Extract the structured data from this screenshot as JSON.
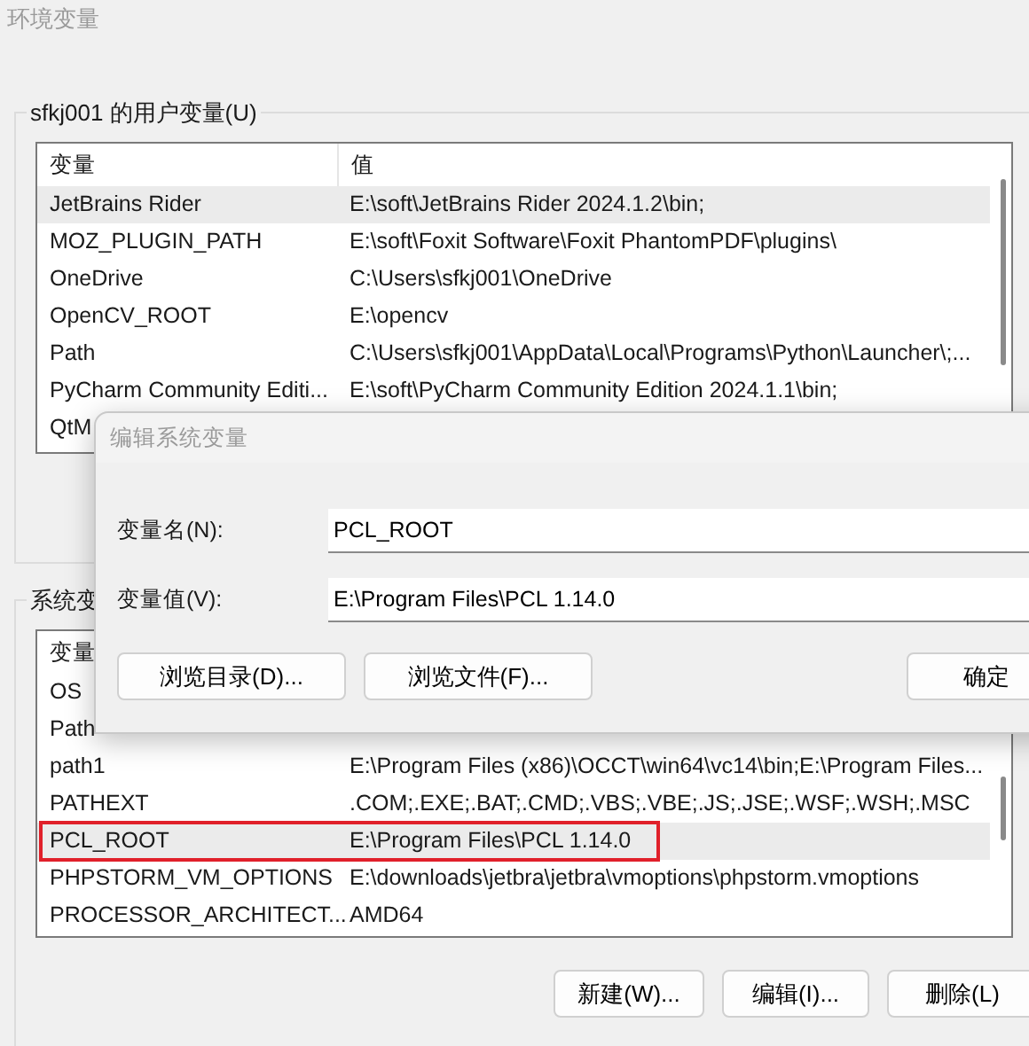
{
  "window": {
    "title": "环境变量"
  },
  "user_variables": {
    "label": "sfkj001 的用户变量(U)",
    "columns": [
      "变量",
      "值"
    ],
    "rows": [
      {
        "name": "JetBrains Rider",
        "value": "E:\\soft\\JetBrains Rider 2024.1.2\\bin;",
        "selected": true
      },
      {
        "name": "MOZ_PLUGIN_PATH",
        "value": "E:\\soft\\Foxit Software\\Foxit PhantomPDF\\plugins\\",
        "selected": false
      },
      {
        "name": "OneDrive",
        "value": "C:\\Users\\sfkj001\\OneDrive",
        "selected": false
      },
      {
        "name": "OpenCV_ROOT",
        "value": "E:\\opencv",
        "selected": false
      },
      {
        "name": "Path",
        "value": "C:\\Users\\sfkj001\\AppData\\Local\\Programs\\Python\\Launcher\\;...",
        "selected": false
      },
      {
        "name": "PyCharm Community Editi...",
        "value": "E:\\soft\\PyCharm Community Edition 2024.1.1\\bin;",
        "selected": false
      },
      {
        "name": "QtM",
        "selected": false
      }
    ]
  },
  "system_variables": {
    "label": "系统变",
    "columns": [
      "变量"
    ],
    "rows": [
      {
        "name": "OS",
        "selected": false,
        "marked": false
      },
      {
        "name": "Path",
        "selected": false,
        "marked": false
      },
      {
        "name": "path1",
        "value": "E:\\Program Files (x86)\\OCCT\\win64\\vc14\\bin;E:\\Program Files...",
        "selected": false,
        "marked": false
      },
      {
        "name": "PATHEXT",
        "value": ".COM;.EXE;.BAT;.CMD;.VBS;.VBE;.JS;.JSE;.WSF;.WSH;.MSC",
        "selected": false,
        "marked": false
      },
      {
        "name": "PCL_ROOT",
        "value": "E:\\Program Files\\PCL 1.14.0",
        "selected": true,
        "marked": true
      },
      {
        "name": "PHPSTORM_VM_OPTIONS",
        "value": "E:\\downloads\\jetbra\\jetbra\\vmoptions\\phpstorm.vmoptions",
        "selected": false,
        "marked": false
      },
      {
        "name": "PROCESSOR_ARCHITECT...",
        "value": "AMD64",
        "selected": false,
        "marked": false
      }
    ],
    "buttons": [
      "新建(W)...",
      "编辑(I)...",
      "删除(L)"
    ]
  },
  "dialog": {
    "title": "编辑系统变量",
    "fields": [
      {
        "label": "变量名(N):",
        "value": "PCL_ROOT"
      },
      {
        "label": "变量值(V):",
        "value": "E:\\Program Files\\PCL 1.14.0"
      }
    ],
    "buttons": [
      "浏览目录(D)...",
      "浏览文件(F)...",
      "确定"
    ]
  }
}
